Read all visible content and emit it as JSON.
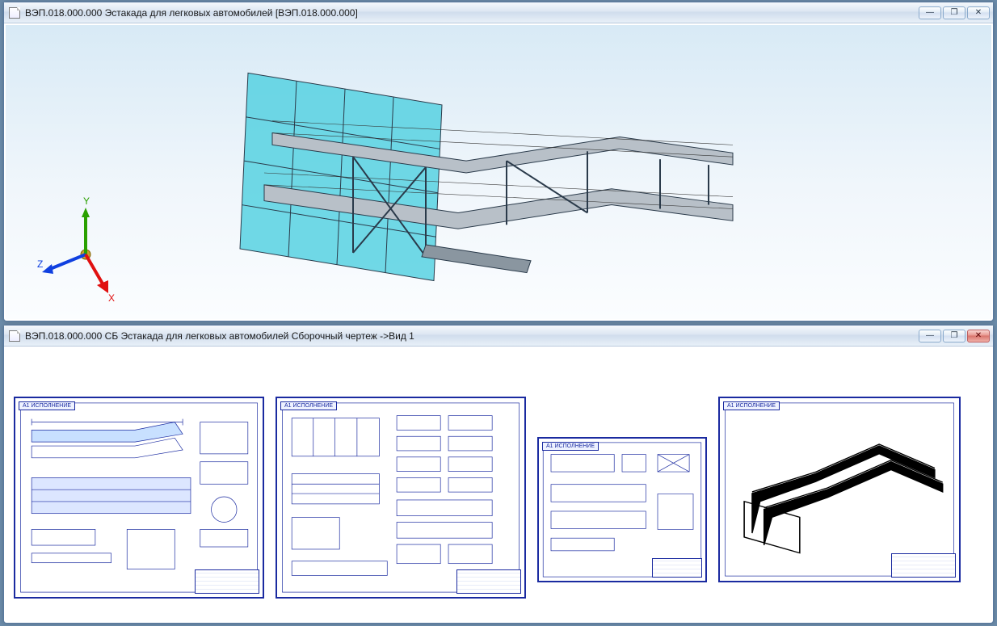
{
  "windows": {
    "model": {
      "title": "ВЭП.018.000.000 Эстакада для легковых автомобилей [ВЭП.018.000.000]",
      "axes": {
        "x": "X",
        "y": "Y",
        "z": "Z"
      }
    },
    "drawing": {
      "title": "ВЭП.018.000.000 СБ Эстакада для легковых автомобилей Сборочный чертеж ->Вид 1",
      "sheet_tag": "А1 ИСПОЛНЕНИЕ"
    }
  },
  "buttons": {
    "minimize": "—",
    "maximize": "❐",
    "close": "✕"
  }
}
